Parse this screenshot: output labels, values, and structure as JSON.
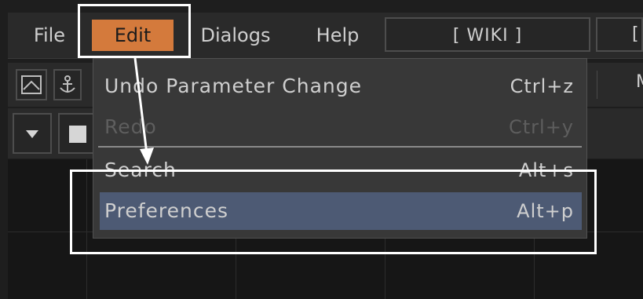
{
  "menubar": {
    "items": [
      {
        "label": "File"
      },
      {
        "label": "Edit"
      },
      {
        "label": "Dialogs"
      },
      {
        "label": "Help"
      }
    ],
    "wiki_label": "[ WIKI ]",
    "edge_label": "["
  },
  "toolbar": {
    "icons": [
      "image-icon",
      "anchor-icon",
      "dropdown-arrow-icon",
      "square-icon"
    ],
    "edge_text": "M"
  },
  "edit_menu": {
    "items": [
      {
        "label": "Undo Parameter Change",
        "shortcut": "Ctrl+z",
        "enabled": true
      },
      {
        "label": "Redo",
        "shortcut": "Ctrl+y",
        "enabled": false
      },
      {
        "label": "Search",
        "shortcut": "Alt+s",
        "enabled": true
      },
      {
        "label": "Preferences",
        "shortcut": "Alt+p",
        "enabled": true,
        "highlighted": true
      }
    ]
  },
  "colors": {
    "menu_active": "#d47a3c",
    "highlight": "#4d5a74",
    "annotation": "#ffffff"
  }
}
